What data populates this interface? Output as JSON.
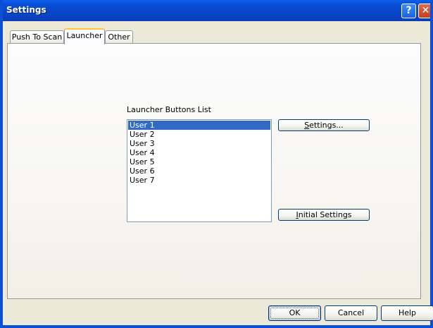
{
  "window": {
    "title": "Settings",
    "help_glyph": "?",
    "close_glyph": "✕"
  },
  "tabs": [
    {
      "label": "Push To Scan",
      "active": false
    },
    {
      "label": "Launcher",
      "active": true
    },
    {
      "label": "Other",
      "active": false
    }
  ],
  "launcher": {
    "list_label": "Launcher Buttons List",
    "items": [
      {
        "label": "User 1",
        "selected": true
      },
      {
        "label": "User 2",
        "selected": false
      },
      {
        "label": "User 3",
        "selected": false
      },
      {
        "label": "User 4",
        "selected": false
      },
      {
        "label": "User 5",
        "selected": false
      },
      {
        "label": "User 6",
        "selected": false
      },
      {
        "label": "User 7",
        "selected": false
      }
    ],
    "settings_button": {
      "accel": "S",
      "rest": "ettings..."
    },
    "initial_settings_button": {
      "accel": "I",
      "rest": "nitial Settings"
    }
  },
  "footer": {
    "ok_label": "OK",
    "cancel_label": "Cancel",
    "help_label": "Help"
  },
  "colors": {
    "titlebar": "#0A4FD6",
    "selection": "#316AC5",
    "active_tab_accent": "#FFC83C",
    "dialog_bg": "#ECE9D8"
  },
  "icons": {
    "help": "help-icon",
    "close": "close-icon"
  }
}
